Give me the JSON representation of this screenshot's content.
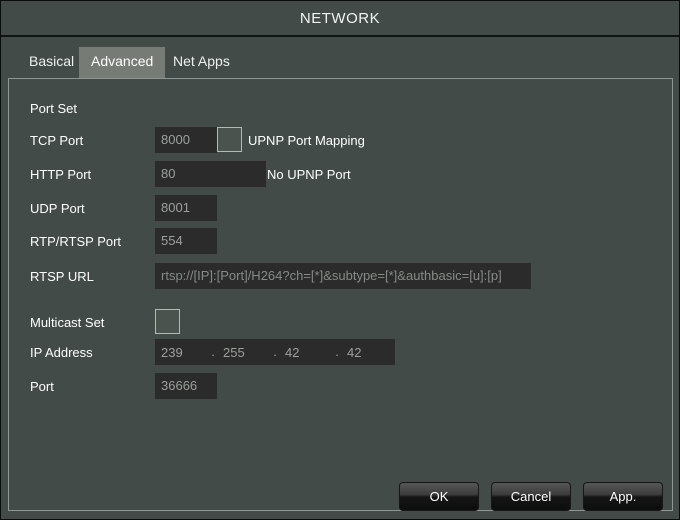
{
  "window": {
    "title": "NETWORK"
  },
  "tabs": [
    {
      "label": "Basical",
      "active": false
    },
    {
      "label": "Advanced",
      "active": true
    },
    {
      "label": "Net Apps",
      "active": false
    }
  ],
  "panel": {
    "section_title": "Port Set",
    "rows": {
      "tcp_port": {
        "label": "TCP Port",
        "value": "8000",
        "checkbox_label": "UPNP Port Mapping",
        "checked": false
      },
      "http_port": {
        "label": "HTTP Port",
        "value": "80",
        "side_label": "No UPNP Port"
      },
      "udp_port": {
        "label": "UDP Port",
        "value": "8001"
      },
      "rtp_rtsp_port": {
        "label": "RTP/RTSP Port",
        "value": "554"
      },
      "rtsp_url": {
        "label": "RTSP URL",
        "value": "rtsp://[IP]:[Port]/H264?ch=[*]&subtype=[*]&authbasic=[u]:[p]"
      },
      "multicast_set": {
        "label": "Multicast Set",
        "checked": false
      },
      "ip_address": {
        "label": "IP Address",
        "octets": [
          "239",
          "255",
          "42",
          "42"
        ],
        "separator": "."
      },
      "multicast_port": {
        "label": "Port",
        "value": "36666"
      }
    }
  },
  "buttons": {
    "ok": "OK",
    "cancel": "Cancel",
    "apply": "App."
  },
  "colors": {
    "window_bg": "#424b47",
    "field_bg": "#2b2b2b",
    "tab_active_bg": "#767b76",
    "text": "#ffffff",
    "field_text": "#9aa09a",
    "panel_border": "#8f958f"
  }
}
